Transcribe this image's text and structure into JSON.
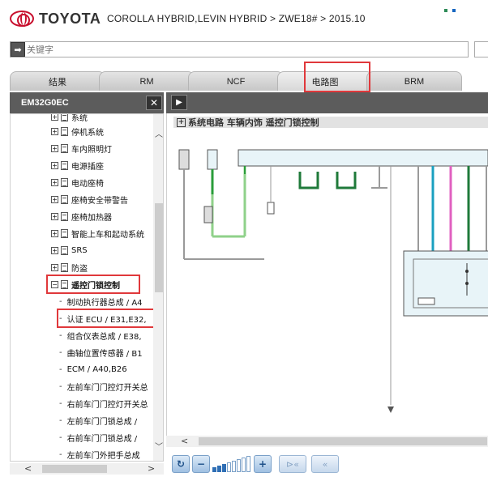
{
  "header": {
    "brand": "TOYOTA",
    "breadcrumb": "COROLLA HYBRID,LEVIN HYBRID > ZWE18# > 2015.10"
  },
  "search": {
    "placeholder": "关键字"
  },
  "tabs": [
    {
      "label": "结果"
    },
    {
      "label": "RM"
    },
    {
      "label": "NCF"
    },
    {
      "label": "电路图",
      "active": true
    },
    {
      "label": "BRM"
    }
  ],
  "left_panel": {
    "title": "EM32G0EC",
    "close_label": "✕",
    "tree": [
      {
        "label": "系统",
        "expander": "+"
      },
      {
        "label": "停机系统",
        "expander": "+"
      },
      {
        "label": "车内照明灯",
        "expander": "+"
      },
      {
        "label": "电源插座",
        "expander": "+"
      },
      {
        "label": "电动座椅",
        "expander": "+"
      },
      {
        "label": "座椅安全带警告",
        "expander": "+"
      },
      {
        "label": "座椅加热器",
        "expander": "+"
      },
      {
        "label": "智能上车和起动系统",
        "expander": "+"
      },
      {
        "label": "SRS",
        "expander": "+"
      },
      {
        "label": "防盗",
        "expander": "+"
      },
      {
        "label": "遥控门锁控制",
        "expander": "−",
        "highlighted": true
      }
    ],
    "leaves": [
      {
        "label": "制动执行器总成 / A4"
      },
      {
        "label": "认证 ECU / E31,E32,",
        "highlighted": true
      },
      {
        "label": "组合仪表总成 / E38,"
      },
      {
        "label": "曲轴位置传感器 / B1"
      },
      {
        "label": "ECM / A40,B26"
      },
      {
        "label": "左前车门门控灯开关总"
      },
      {
        "label": "右前车门门控灯开关总"
      },
      {
        "label": "左前车门门锁总成 /"
      },
      {
        "label": "右前车门门锁总成 /"
      },
      {
        "label": "左前车门外把手总成"
      }
    ]
  },
  "right_panel": {
    "diagram_title": "系统电路   车辆内饰   遥控门锁控制"
  },
  "toolbar": {
    "zoom_level_bars": 8,
    "zoom_level_active": 3,
    "refresh_icon": "↻",
    "zoom_out_icon": "🔍−",
    "zoom_in_icon": "🔍+",
    "prev_icon": "⊳«",
    "next_icon": "«"
  },
  "colors": {
    "highlight": "#e0383b",
    "panel_header": "#5c5c5c",
    "wire_green": "#2a9d3a",
    "wire_lightgreen": "#8fd18a",
    "wire_cyan": "#1aa0c0",
    "wire_pink": "#e060c0",
    "wire_darkgreen": "#1f7a3a",
    "wire_gray": "#9a9a9a"
  }
}
